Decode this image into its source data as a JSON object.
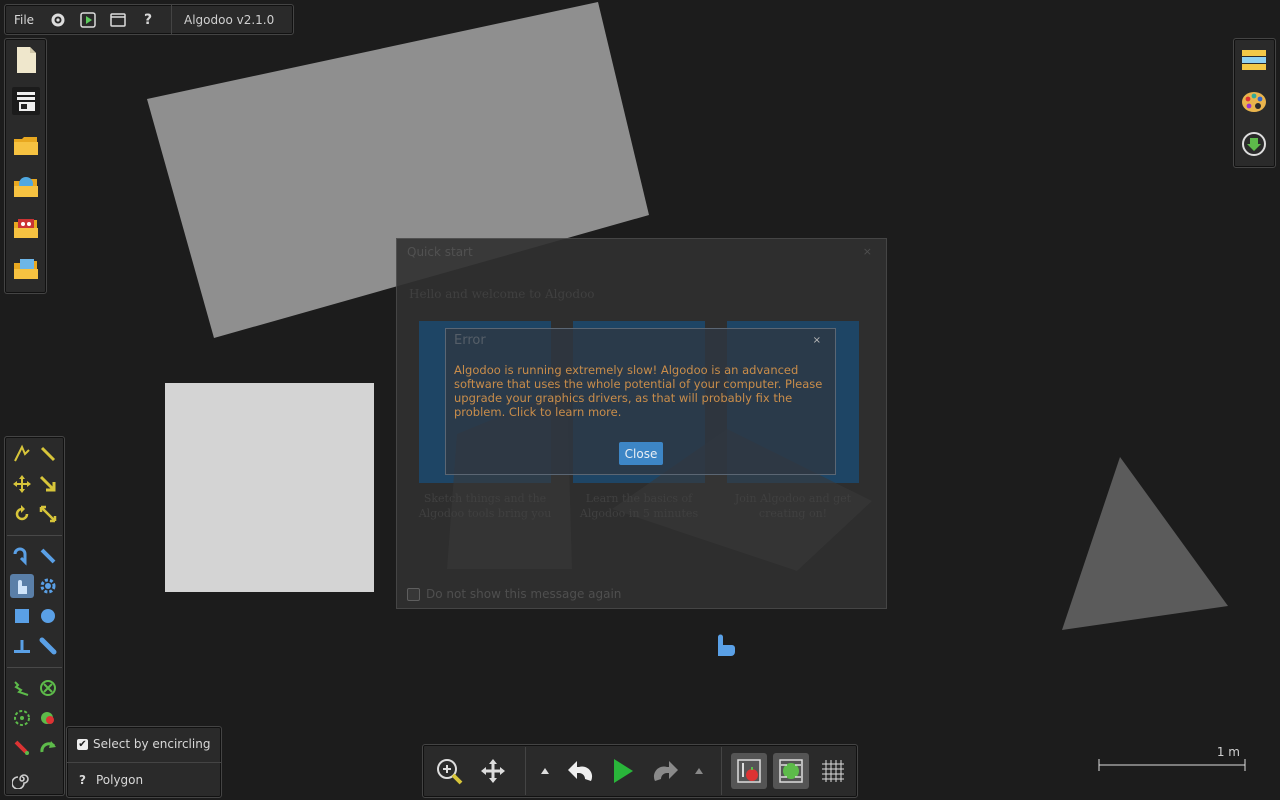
{
  "menu": {
    "file_label": "File",
    "icons": [
      "settings-icon",
      "play-scene-icon",
      "window-icon",
      "help-icon"
    ],
    "help_label": "?",
    "version": "Algodoo v2.1.0"
  },
  "left_toolbar": [
    "new-scene-icon",
    "scene-browser-icon",
    "open-folder-icon",
    "online-folder-icon",
    "lessons-folder-icon",
    "save-folder-icon"
  ],
  "right_toolbar": [
    "layers-icon",
    "palette-icon",
    "download-icon"
  ],
  "welcome_dialog": {
    "title": "Quick start",
    "subtitle": "Hello and welcome to Algodoo",
    "card_captions": [
      "Sketch things and the Algodoo tools bring you",
      "Learn the basics of Algodoo in 5 minutes",
      "Join Algodoo and get creating on!"
    ],
    "checkbox_label": "Do not show this message again"
  },
  "error_dialog": {
    "title": "Error",
    "close_x": "×",
    "message": "Algodoo is running extremely slow! Algodoo is an advanced software that uses the whole potential of your computer. Please upgrade your graphics drivers, as that will probably fix the problem. Click to learn more.",
    "close_button": "Close"
  },
  "tool_options": {
    "select_by_encircling": "Select by encircling",
    "select_checked": true,
    "polygon_prefix": "?",
    "polygon_label": "Polygon"
  },
  "scale_bar": {
    "label": "1 m"
  },
  "colors": {
    "canvas": "#1c1c1c",
    "accent_blue": "#3d86c6",
    "warning_text": "#c98d4a",
    "play_green": "#29b53a"
  }
}
